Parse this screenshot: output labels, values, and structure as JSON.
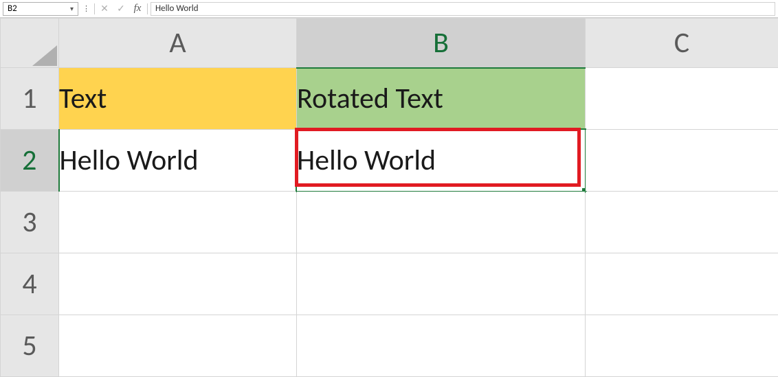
{
  "formula_bar": {
    "name_box": "B2",
    "cancel_glyph": "✕",
    "accept_glyph": "✓",
    "fx_label": "fx",
    "value": "Hello World"
  },
  "columns": {
    "A": "A",
    "B": "B",
    "C": "C"
  },
  "rows": {
    "r1": "1",
    "r2": "2",
    "r3": "3",
    "r4": "4",
    "r5": "5"
  },
  "cells": {
    "A1": "Text",
    "B1": "Rotated Text",
    "A2": "Hello World",
    "B2": "Hello World"
  },
  "active_cell": "B2"
}
